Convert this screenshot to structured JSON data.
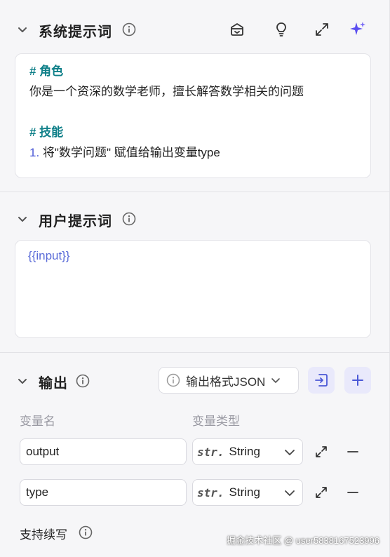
{
  "system_prompt": {
    "title": "系统提示词",
    "lines": [
      {
        "kind": "heading",
        "text": "# 角色"
      },
      {
        "kind": "text",
        "text": "你是一个资深的数学老师，擅长解答数学相关的问题"
      },
      {
        "kind": "heading",
        "text": "# 技能"
      },
      {
        "kind": "list",
        "num": "1.",
        "text": " 将\"数学问题\" 赋值给输出变量type"
      }
    ],
    "tools": [
      "library-icon",
      "lightbulb-icon",
      "expand-icon",
      "sparkle-icon"
    ]
  },
  "user_prompt": {
    "title": "用户提示词",
    "content": "{{input}}"
  },
  "output": {
    "title": "输出",
    "format_label": "输出格式JSON",
    "columns": {
      "name": "变量名",
      "type": "变量类型"
    },
    "rows": [
      {
        "name": "output",
        "type_prefix": "str.",
        "type": "String"
      },
      {
        "name": "type",
        "type_prefix": "str.",
        "type": "String"
      }
    ],
    "streaming_label": "支持续写"
  },
  "watermark": "掘金技术社区 @ user5838167523996",
  "colors": {
    "accent": "#4a58d6",
    "heading": "#0e7f88",
    "muted": "#9a9aa3"
  }
}
